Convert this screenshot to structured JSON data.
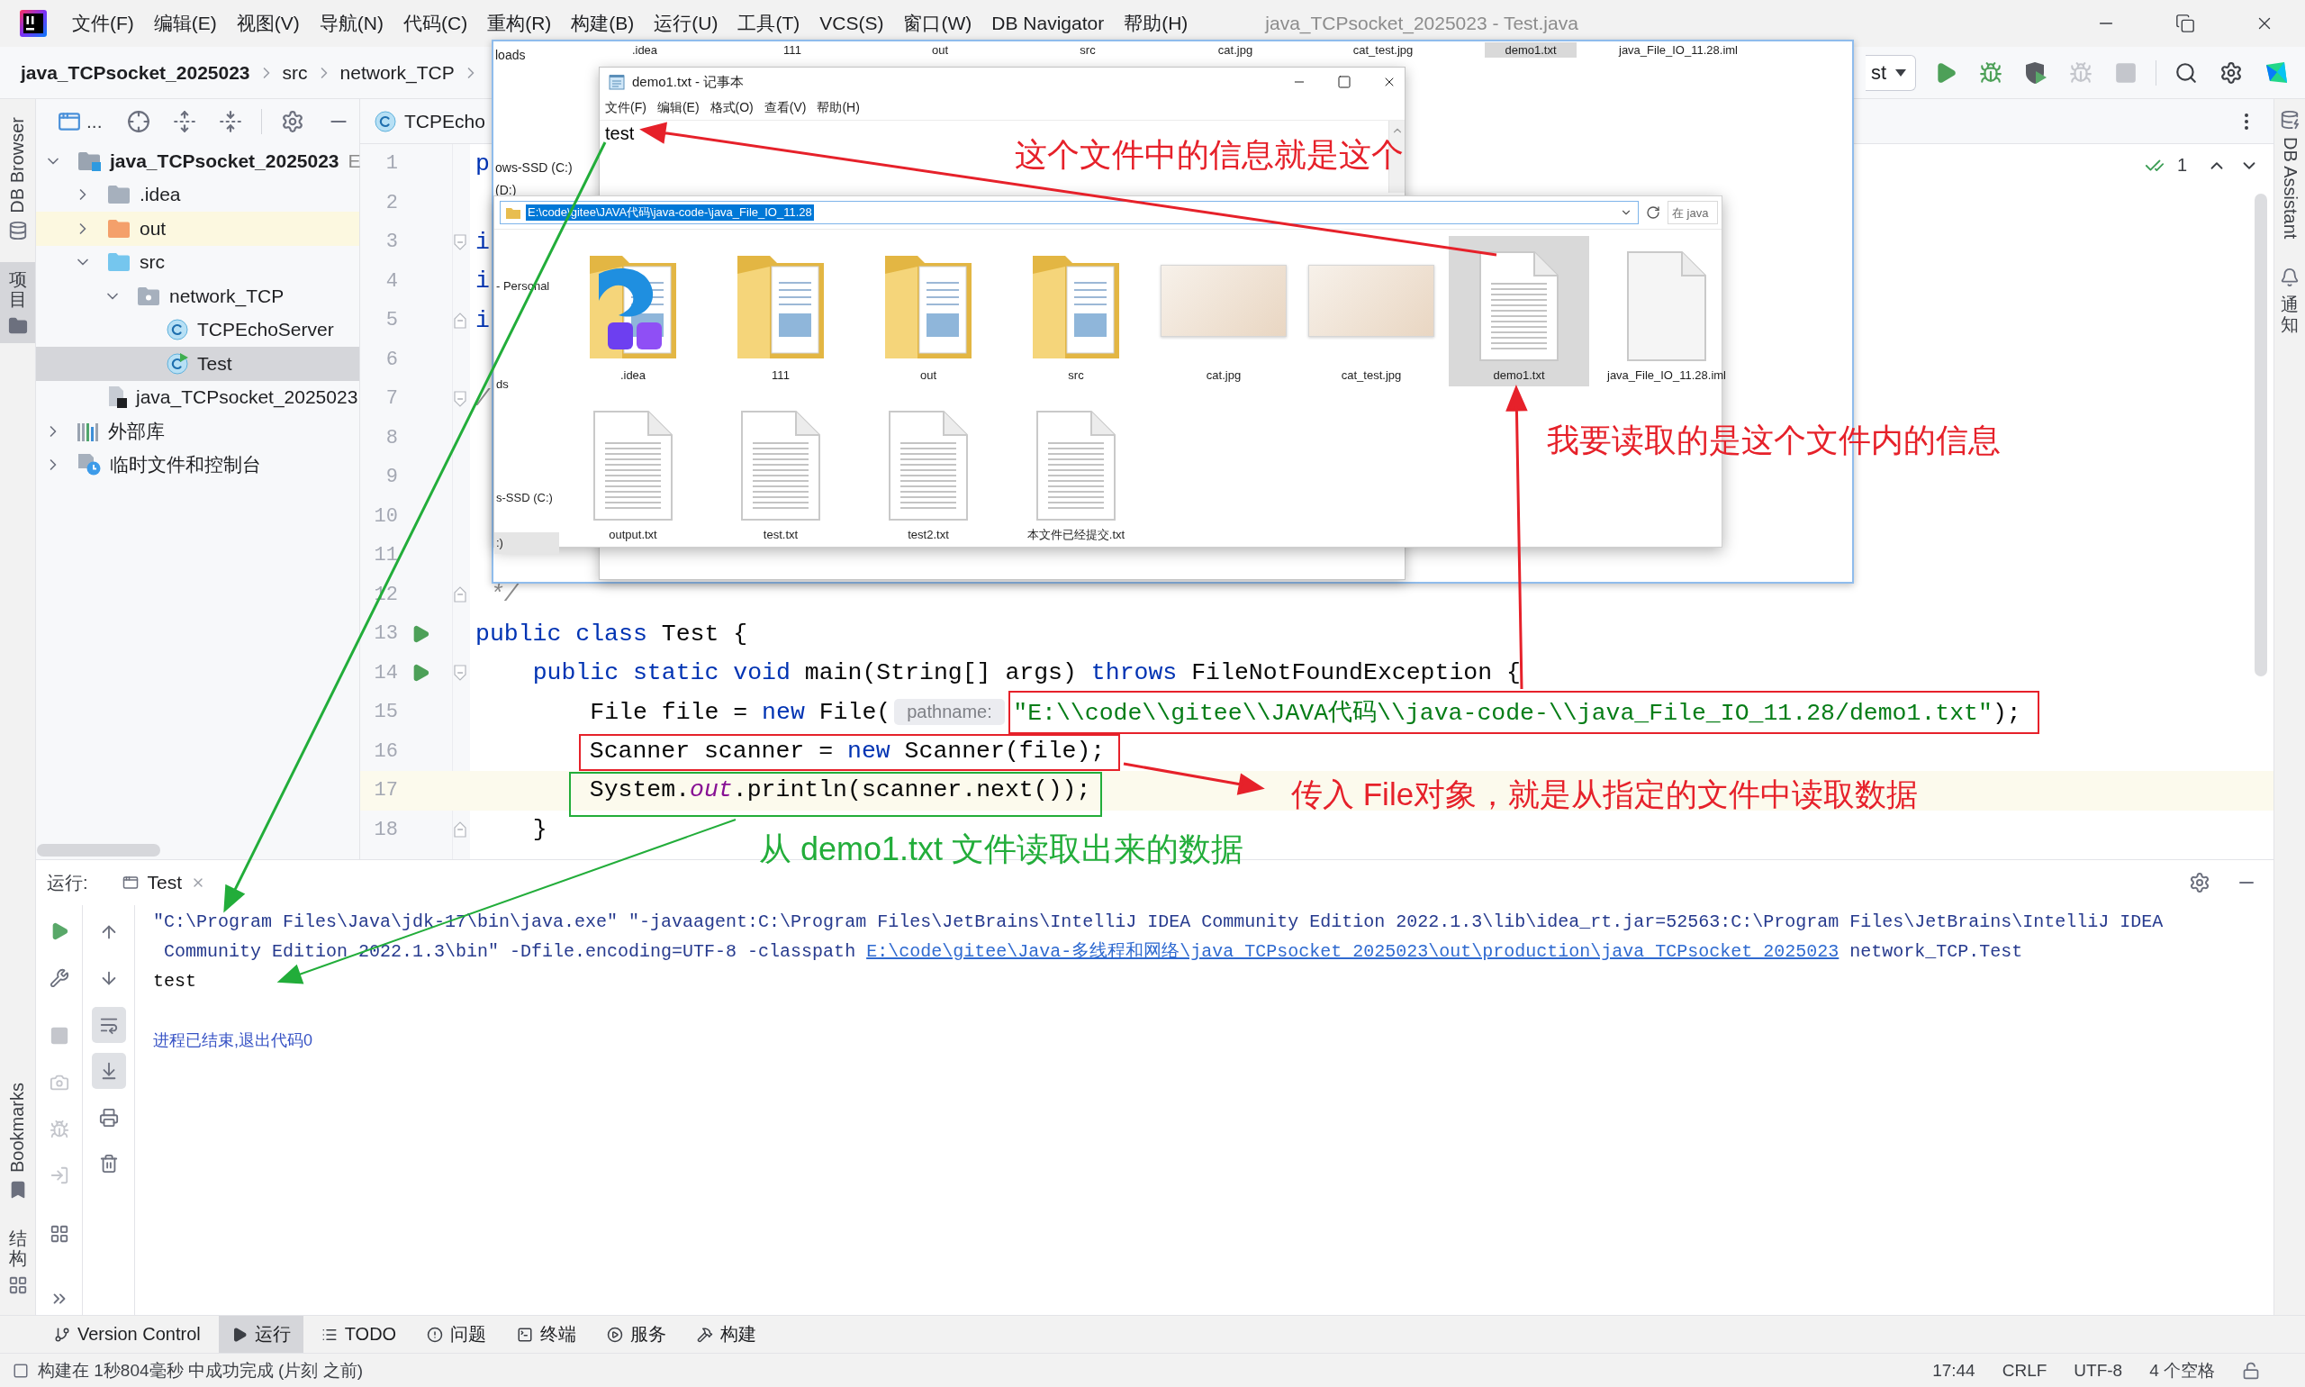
{
  "title_bar": {
    "menu": [
      "文件(F)",
      "编辑(E)",
      "视图(V)",
      "导航(N)",
      "代码(C)",
      "重构(R)",
      "构建(B)",
      "运行(U)",
      "工具(T)",
      "VCS(S)",
      "窗口(W)",
      "DB Navigator",
      "帮助(H)"
    ],
    "title": "java_TCPsocket_2025023 - Test.java"
  },
  "nav_bar": {
    "breadcrumbs": [
      "java_TCPsocket_2025023",
      "src",
      "network_TCP"
    ],
    "run_config": "st"
  },
  "left_strip": {
    "top": [
      {
        "label": "DB Browser",
        "kind": "database",
        "selected": false
      },
      {
        "label": "项目",
        "kind": "project",
        "selected": true
      }
    ],
    "bottom": [
      {
        "label": "Bookmarks",
        "kind": "bookmarks"
      },
      {
        "label": "结构",
        "kind": "structure"
      }
    ]
  },
  "right_strip": [
    {
      "label": "DB Assistant",
      "kind": "assistant"
    },
    {
      "label": "通知",
      "kind": "notifications"
    }
  ],
  "project_panel": {
    "view_selector": "...",
    "tree": [
      {
        "kind": "module",
        "name": "java_TCPsocket_2025023",
        "path": "E",
        "expanded": true,
        "selected": false,
        "children": [
          {
            "kind": "folder",
            "name": ".idea",
            "expanded": false,
            "selected": false
          },
          {
            "kind": "excluded",
            "name": "out",
            "expanded": false,
            "selected": false
          },
          {
            "kind": "source",
            "name": "src",
            "expanded": true,
            "selected": false,
            "children": [
              {
                "kind": "package",
                "name": "network_TCP",
                "expanded": true,
                "selected": false,
                "children": [
                  {
                    "kind": "class",
                    "name": "TCPEchoServer",
                    "selected": false
                  },
                  {
                    "kind": "main_class",
                    "name": "Test",
                    "selected": true
                  }
                ]
              }
            ]
          },
          {
            "kind": "iml",
            "name": "java_TCPsocket_2025023",
            "selected": false
          }
        ]
      },
      {
        "kind": "library",
        "name": "外部库",
        "expanded": false,
        "selected": false
      },
      {
        "kind": "scratches",
        "name": "临时文件和控制台",
        "expanded": false,
        "selected": false
      }
    ]
  },
  "editor": {
    "tabs": [
      "TCPEcho"
    ],
    "problems": "1",
    "lines": [
      {
        "number": "1",
        "run": false,
        "current": false,
        "fold_start": false,
        "fold_end": false,
        "tokens": [
          {
            "kind": "keyword",
            "text": "p"
          }
        ]
      },
      {
        "number": "2",
        "run": false,
        "current": false,
        "fold_start": false,
        "fold_end": false
      },
      {
        "number": "3",
        "run": false,
        "current": false,
        "fold_start": true,
        "fold_end": false,
        "tokens": [
          {
            "kind": "keyword",
            "text": "i"
          }
        ]
      },
      {
        "number": "4",
        "run": false,
        "current": false,
        "fold_start": false,
        "fold_end": false,
        "tokens": [
          {
            "kind": "keyword",
            "text": "i"
          }
        ]
      },
      {
        "number": "5",
        "run": false,
        "current": false,
        "fold_start": false,
        "fold_end": true,
        "tokens": [
          {
            "kind": "keyword",
            "text": "i"
          }
        ]
      },
      {
        "number": "6",
        "run": false,
        "current": false,
        "fold_start": false,
        "fold_end": false
      },
      {
        "number": "7",
        "run": false,
        "current": false,
        "fold_start": true,
        "fold_end": false,
        "tokens": [
          {
            "kind": "comment",
            "text": "/"
          }
        ]
      },
      {
        "number": "8",
        "run": false,
        "current": false,
        "fold_start": false,
        "fold_end": false
      },
      {
        "number": "9",
        "run": false,
        "current": false,
        "fold_start": false,
        "fold_end": false
      },
      {
        "number": "10",
        "run": false,
        "current": false,
        "fold_start": false,
        "fold_end": false
      },
      {
        "number": "11",
        "run": false,
        "current": false,
        "fold_start": false,
        "fold_end": false
      },
      {
        "number": "12",
        "run": false,
        "current": false,
        "fold_start": false,
        "fold_end": true,
        "tokens": [
          {
            "kind": "comment",
            "text": " */"
          }
        ]
      },
      {
        "number": "13",
        "run": true,
        "current": false,
        "fold_start": false,
        "fold_end": false,
        "tokens": [
          {
            "kind": "keyword",
            "text": "public class"
          },
          {
            "kind": "plain",
            "text": " Test {"
          }
        ]
      },
      {
        "number": "14",
        "run": true,
        "current": false,
        "fold_start": true,
        "fold_end": false,
        "tokens": [
          {
            "kind": "keyword",
            "text": "    public static void"
          },
          {
            "kind": "plain",
            "text": " main(String[] args) "
          },
          {
            "kind": "keyword",
            "text": "throws"
          },
          {
            "kind": "plain",
            "text": " FileNotFoundException {"
          }
        ]
      },
      {
        "number": "15",
        "run": false,
        "current": false,
        "fold_start": false,
        "fold_end": false,
        "tokens": [
          {
            "kind": "plain",
            "text": "        File file = "
          },
          {
            "kind": "keyword",
            "text": "new"
          },
          {
            "kind": "plain",
            "text": " File("
          },
          {
            "kind": "hint",
            "text": "pathname:"
          },
          {
            "kind": "string",
            "text": "\"E:\\\\code\\\\gitee\\\\JAVA代码\\\\java-code-\\\\java_File_IO_11.28/demo1.txt\""
          },
          {
            "kind": "plain",
            "text": ");"
          }
        ]
      },
      {
        "number": "16",
        "run": false,
        "current": false,
        "fold_start": false,
        "fold_end": false,
        "tokens": [
          {
            "kind": "plain",
            "text": "        Scanner scanner = "
          },
          {
            "kind": "keyword",
            "text": "new"
          },
          {
            "kind": "plain",
            "text": " Scanner(file);"
          }
        ]
      },
      {
        "number": "17",
        "run": false,
        "current": true,
        "fold_start": false,
        "fold_end": false,
        "tokens": [
          {
            "kind": "plain",
            "text": "        System."
          },
          {
            "kind": "field",
            "text": "out"
          },
          {
            "kind": "plain",
            "text": ".println(scanner.next());"
          }
        ]
      },
      {
        "number": "18",
        "run": false,
        "current": false,
        "fold_start": false,
        "fold_end": true,
        "tokens": [
          {
            "kind": "plain",
            "text": "    }"
          }
        ]
      }
    ]
  },
  "screenshot": {
    "back_window": {
      "file_labels": [
        {
          "label": ".idea",
          "selected": false
        },
        {
          "label": "111",
          "selected": false
        },
        {
          "label": "out",
          "selected": false
        },
        {
          "label": "src",
          "selected": false
        },
        {
          "label": "cat.jpg",
          "selected": false
        },
        {
          "label": "cat_test.jpg",
          "selected": false
        },
        {
          "label": "demo1.txt",
          "selected": true
        },
        {
          "label": "java_File_IO_11.28.iml",
          "selected": false
        }
      ],
      "nav_items": [
        "loads",
        "ows-SSD (C:)",
        "(D:)"
      ]
    },
    "notepad": {
      "title": "demo1.txt - 记事本",
      "menu": [
        "文件(F)",
        "编辑(E)",
        "格式(O)",
        "查看(V)",
        "帮助(H)"
      ],
      "content": "test"
    },
    "explorer": {
      "address": {
        "value": "E:\\code\\gitee\\JAVA代码\\java-code-\\java_File_IO_11.28",
        "selected": true
      },
      "search": {
        "placeholder": "在 java"
      },
      "nav_items": [
        {
          "label": "- Personal",
          "selected": false
        },
        {
          "label": "ds",
          "selected": false
        },
        {
          "label": "s-SSD (C:)",
          "selected": false
        },
        {
          "label": ":)",
          "selected": true
        }
      ],
      "files": [
        {
          "name": ".idea",
          "kind": "app_folder",
          "selected": false
        },
        {
          "name": "111",
          "kind": "folder",
          "selected": false
        },
        {
          "name": "out",
          "kind": "folder",
          "selected": false
        },
        {
          "name": "src",
          "kind": "folder",
          "selected": false
        },
        {
          "name": "cat.jpg",
          "kind": "image",
          "selected": false
        },
        {
          "name": "cat_test.jpg",
          "kind": "image",
          "selected": false
        },
        {
          "name": "demo1.txt",
          "kind": "text",
          "selected": true
        },
        {
          "name": "java_File_IO_11.28.iml",
          "kind": "file",
          "selected": false
        },
        {
          "name": "output.txt",
          "kind": "text",
          "selected": false
        },
        {
          "name": "test.txt",
          "kind": "text",
          "selected": false
        },
        {
          "name": "test2.txt",
          "kind": "text",
          "selected": false
        },
        {
          "name": "本文件已经提交.txt",
          "kind": "text",
          "selected": false
        }
      ]
    }
  },
  "annotations": [
    {
      "text": "这个文件中的信息就是这个",
      "color": "#e6212a"
    },
    {
      "text": "我要读取的是这个文件内的信息",
      "color": "#e6212a"
    },
    {
      "text": "传入 File对象，就是从指定的文件中读取数据",
      "color": "#e6212a"
    },
    {
      "text": "从 demo1.txt 文件读取出来的数据",
      "color": "#22ad3a"
    }
  ],
  "run_panel": {
    "label": "运行:",
    "tab": "Test",
    "soft_wrap": true,
    "scroll_to_end": true,
    "console": [
      {
        "kind": "command",
        "parts": [
          {
            "text": "\"C:\\Program Files\\Java\\jdk-17\\bin\\java.exe\" \"-javaagent:C:\\Program Files\\JetBrains\\IntelliJ IDEA Community Edition 2022.1.3\\lib\\idea_rt.jar=52563:C:\\Program Files\\JetBrains\\IntelliJ IDEA",
            "link": false
          }
        ]
      },
      {
        "kind": "command",
        "parts": [
          {
            "text": " Community Edition 2022.1.3\\bin\" -Dfile.encoding=UTF-8 -classpath ",
            "link": false
          },
          {
            "text": "E:\\code\\gitee\\Java-多线程和网络\\java_TCPsocket_2025023\\out\\production\\java_TCPsocket_2025023",
            "link": true
          },
          {
            "text": " network_TCP.Test",
            "link": false
          }
        ]
      },
      {
        "kind": "output",
        "parts": [
          {
            "text": "test",
            "link": false
          }
        ]
      },
      {
        "kind": "exit",
        "parts": [
          {
            "text": "进程已结束,退出代码0",
            "link": false
          }
        ]
      }
    ]
  },
  "tool_windows": [
    {
      "label": "Version Control",
      "kind": "vcs",
      "selected": false
    },
    {
      "label": "运行",
      "kind": "run",
      "selected": true
    },
    {
      "label": "TODO",
      "kind": "todo",
      "selected": false
    },
    {
      "label": "问题",
      "kind": "problems",
      "selected": false
    },
    {
      "label": "终端",
      "kind": "terminal",
      "selected": false
    },
    {
      "label": "服务",
      "kind": "services",
      "selected": false
    },
    {
      "label": "构建",
      "kind": "build",
      "selected": false
    }
  ],
  "status_bar": {
    "message": "构建在 1秒804毫秒 中成功完成 (片刻 之前)",
    "items": [
      "17:44",
      "CRLF",
      "UTF-8",
      "4 个空格"
    ]
  }
}
